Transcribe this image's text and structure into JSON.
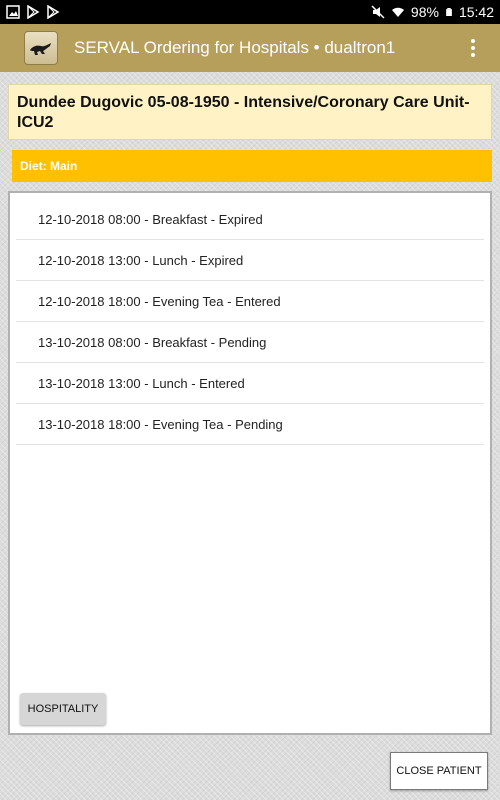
{
  "status_bar": {
    "battery": "98%",
    "time": "15:42",
    "left_icons": [
      "image-icon",
      "play-store-icon",
      "play-store-icon"
    ],
    "right_icons": [
      "mute-icon",
      "wifi-icon",
      "battery-icon"
    ]
  },
  "app_bar": {
    "title": "SERVAL Ordering for Hospitals • dualtron1",
    "color": "#b59f5b",
    "logo_icon": "serval-logo-icon",
    "menu_icon": "overflow-menu-icon"
  },
  "patient": {
    "header": "Dundee Dugovic 05-08-1950 - Intensive/Coronary Care Unit-ICU2"
  },
  "diet": {
    "label": "Diet: Main",
    "color": "#ffc000"
  },
  "meals": [
    "12-10-2018 08:00 - Breakfast - Expired",
    "12-10-2018 13:00 - Lunch - Expired",
    "12-10-2018 18:00 - Evening Tea - Entered",
    "13-10-2018 08:00 - Breakfast - Pending",
    "13-10-2018 13:00 - Lunch - Entered",
    "13-10-2018 18:00 - Evening Tea - Pending"
  ],
  "buttons": {
    "hospitality": "HOSPITALITY",
    "close_patient": "CLOSE PATIENT"
  }
}
